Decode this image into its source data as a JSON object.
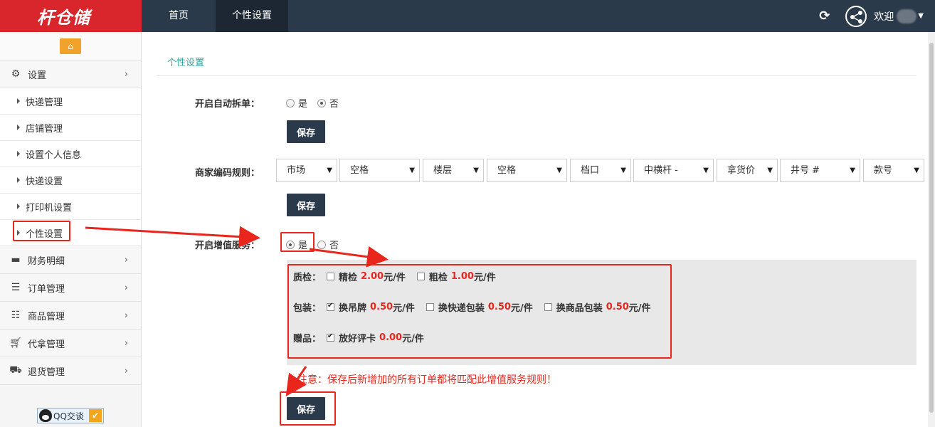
{
  "header": {
    "logo_text": "杆仓储",
    "nav": [
      {
        "label": "首页"
      },
      {
        "label": "个性设置"
      }
    ],
    "welcome": "欢迎"
  },
  "sidebar": {
    "groups": [
      {
        "label": "设置",
        "icon": "gears-icon",
        "expanded": true
      },
      {
        "label": "财务明细",
        "icon": "briefcase-icon"
      },
      {
        "label": "订单管理",
        "icon": "bars-icon"
      },
      {
        "label": "商品管理",
        "icon": "list-icon"
      },
      {
        "label": "代拿管理",
        "icon": "cart-icon"
      },
      {
        "label": "退货管理",
        "icon": "truck-icon"
      }
    ],
    "sub_items": [
      "快递管理",
      "店铺管理",
      "设置个人信息",
      "快递设置",
      "打印机设置",
      "个性设置"
    ],
    "active_sub": "个性设置",
    "qq_label": "QQ交谈"
  },
  "main": {
    "breadcrumb": "个性设置",
    "auto_split": {
      "label": "开启自动拆单：",
      "options": [
        "是",
        "否"
      ],
      "selected": "否",
      "save": "保存"
    },
    "code_rule": {
      "label": "商家编码规则：",
      "selects": [
        "市场",
        "空格",
        "楼层",
        "空格",
        "档口",
        "中横杆 -",
        "拿货价",
        "井号 #",
        "款号"
      ],
      "save": "保存"
    },
    "value_added": {
      "label": "开启增值服务：",
      "options": [
        "是",
        "否"
      ],
      "selected": "是",
      "rows": [
        {
          "label": "质检：",
          "items": [
            {
              "name": "精检",
              "price": "2.00",
              "unit": "元/件",
              "checked": false
            },
            {
              "name": "粗检",
              "price": "1.00",
              "unit": "元/件",
              "checked": false
            }
          ]
        },
        {
          "label": "包装：",
          "items": [
            {
              "name": "换吊牌",
              "price": "0.50",
              "unit": "元/件",
              "checked": true
            },
            {
              "name": "换快递包装",
              "price": "0.50",
              "unit": "元/件",
              "checked": false
            },
            {
              "name": "换商品包装",
              "price": "0.50",
              "unit": "元/件",
              "checked": false
            }
          ]
        },
        {
          "label": "赠品：",
          "items": [
            {
              "name": "放好评卡",
              "price": "0.00",
              "unit": "元/件",
              "checked": true
            }
          ]
        }
      ],
      "notice": "注意：保存后新增加的所有订单都将匹配此增值服务规则！",
      "save": "保存"
    }
  },
  "colors": {
    "accent_red": "#e8261c",
    "topbar": "#2b3a4a",
    "logo_bg": "#d9262c",
    "home_btn": "#f0a22b",
    "breadcrumb": "#2aa5a0"
  }
}
